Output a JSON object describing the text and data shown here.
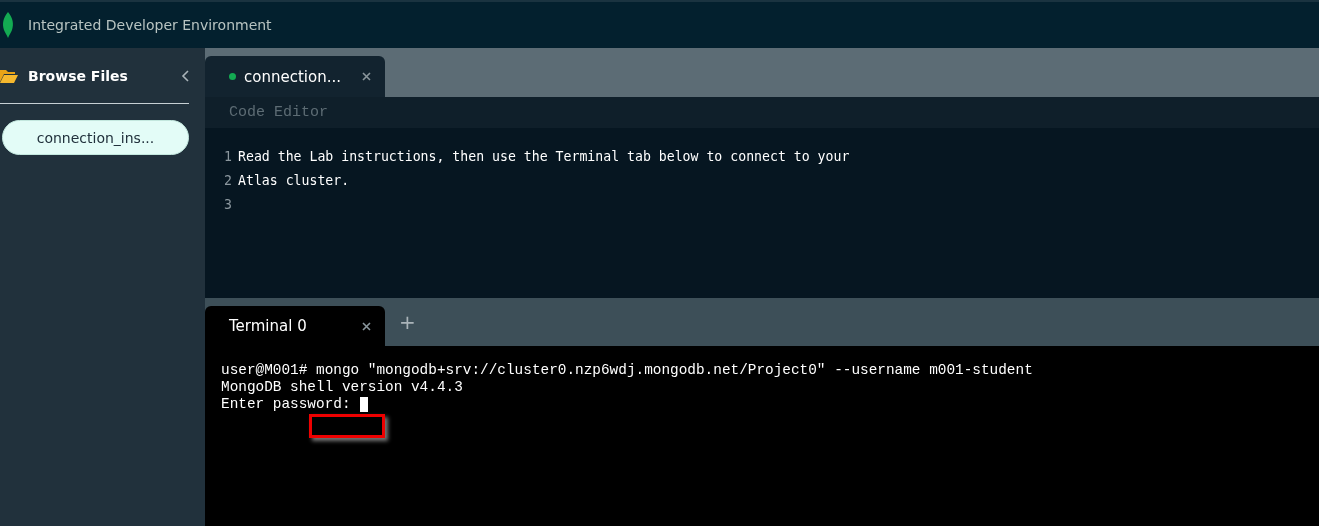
{
  "header": {
    "title": "Integrated Developer Environment"
  },
  "sidebar": {
    "title": "Browse Files",
    "files": [
      {
        "name": "connection_ins...",
        "selected": true
      }
    ]
  },
  "editor": {
    "tabs": [
      {
        "label": "connection...",
        "selected": true,
        "modified": true
      }
    ],
    "panel_label": "Code Editor",
    "lines": [
      {
        "number": "1",
        "text": "Read the Lab instructions, then use the Terminal tab below to connect to your"
      },
      {
        "number": "2",
        "text": "Atlas cluster."
      },
      {
        "number": "3"
      }
    ]
  },
  "terminal": {
    "tabs": [
      {
        "label": "Terminal 0",
        "selected": true
      }
    ],
    "add_tab": "+",
    "lines": [
      "user@M001# mongo \"mongodb+srv://cluster0.nzp6wdj.mongodb.net/Project0\" --username m001-student",
      "MongoDB shell version v4.4.3",
      "Enter password:"
    ],
    "cursor": true,
    "annotation": {
      "kind": "highlight-box"
    }
  }
}
